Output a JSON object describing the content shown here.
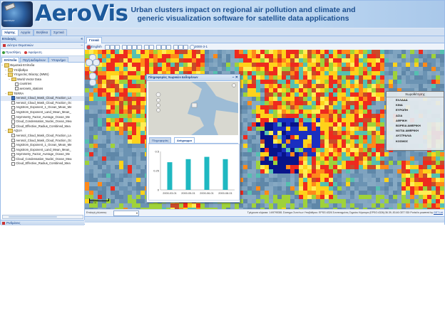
{
  "banner": {
    "brand": "AeroVis",
    "tagline": "Urban clusters impact on regional air pollution and climate and generic visualization software for satellite data applications"
  },
  "nav": {
    "tabs": [
      "Χάρτης",
      "Αρχεία",
      "Βοήθεια",
      "Σχετικά"
    ],
    "active": 0
  },
  "left_panel": {
    "title": "Επιλογές",
    "layers_header": "Δέντρο Θεματικών",
    "add_label": "Προσθήκη",
    "remove_label": "Αφαίρεση",
    "tabs": [
      "Επίπεδα",
      "Πηγή Δεδομένων",
      "Υπομνήμα"
    ],
    "tree": [
      {
        "label": "Θεματικά Επίπεδα",
        "level": 0,
        "type": "folder"
      },
      {
        "label": "Υπόβαθρα",
        "level": 1,
        "type": "folder"
      },
      {
        "label": "Υπηρεσίες Θέασης (WMS)",
        "level": 1,
        "type": "folder"
      },
      {
        "label": "World Vector Data",
        "level": 2,
        "type": "folder"
      },
      {
        "label": "countries",
        "level": 3,
        "type": "layer",
        "checked": false
      },
      {
        "label": "aeronets_stations",
        "level": 3,
        "type": "layer",
        "checked": false
      },
      {
        "label": "TERRA",
        "level": 1,
        "type": "folder"
      },
      {
        "label": "Aerosol_Cloud_Mask_Cloud_Fraction_La",
        "level": 2,
        "type": "layer",
        "checked": true,
        "selected": true
      },
      {
        "label": "Aerosol_Cloud_Mask_Cloud_Fraction_Oc",
        "level": 2,
        "type": "layer",
        "checked": false
      },
      {
        "label": "Angstrom_Exponent_1_Ocean_Mean_Me",
        "level": 2,
        "type": "layer",
        "checked": false
      },
      {
        "label": "Angstrom_Exponent_Land_Mean_Mean_",
        "level": 2,
        "type": "layer",
        "checked": false
      },
      {
        "label": "Asymmetry_Factor_Average_Ocean_Me",
        "level": 2,
        "type": "layer",
        "checked": false
      },
      {
        "label": "Cloud_Condensation_Nuclei_Ocean_Mea",
        "level": 2,
        "type": "layer",
        "checked": false
      },
      {
        "label": "Cloud_Effective_Radius_Combined_Mea",
        "level": 2,
        "type": "layer",
        "checked": false
      },
      {
        "label": "AQUA",
        "level": 1,
        "type": "folder"
      },
      {
        "label": "Aerosol_Cloud_Mask_Cloud_Fraction_La",
        "level": 2,
        "type": "layer",
        "checked": false
      },
      {
        "label": "Aerosol_Cloud_Mask_Cloud_Fraction_Oc",
        "level": 2,
        "type": "layer",
        "checked": false
      },
      {
        "label": "Angstrom_Exponent_1_Ocean_Mean_Me",
        "level": 2,
        "type": "layer",
        "checked": false
      },
      {
        "label": "Angstrom_Exponent_Land_Mean_Mean_",
        "level": 2,
        "type": "layer",
        "checked": false
      },
      {
        "label": "Asymmetry_Factor_Average_Ocean_Me",
        "level": 2,
        "type": "layer",
        "checked": false
      },
      {
        "label": "Cloud_Condensation_Nuclei_Ocean_Mea",
        "level": 2,
        "type": "layer",
        "checked": false
      },
      {
        "label": "Cloud_Effective_Radius_Combined_Mea",
        "level": 2,
        "type": "layer",
        "checked": false
      }
    ],
    "bottom_title": "Ρυθμίσεις"
  },
  "map_panel": {
    "tab": "Γενικά",
    "toolbar_lang": "English",
    "toolbar_date": "2000-3-1",
    "legend": {
      "title": "Χωροθέτησης",
      "items": [
        "ΕΛΛΑΔΑ",
        "ΚΙΝΑ",
        "ΕΥΡΩΠΗ",
        "ΑΣΙΑ",
        "ΑΦΡΙΚΗ",
        "ΒΟΡΕΙΑ ΑΜΕΡΙΚΗ",
        "ΝΟΤΙΑ ΑΜΕΡΙΚΗ",
        "ΑΥΣΤΡΑΛΙΑ",
        "ΚΟΣΜΟΣ"
      ]
    },
    "popup": {
      "title": "Πληροφορίες Χωρικών Δεδομένων",
      "tabs": [
        "Πληροφορίες",
        "Διάγραμμα"
      ],
      "active_tab": 1
    },
    "scalebar": {
      "top": "1000 km",
      "bottom": "500 mi"
    },
    "status": {
      "lang_label": "Επιλογή γλώσσας:",
      "info": "Τρέχουσα κλίμακα: 1:69795381  Σύστημα Συντ/νων Υποβάθρου: EPSG:4326  Συντεταγμένες Σημείου Κέρσορα (EPSG:4326):36.39, 83.46  GET SDI Portal is powered by ",
      "link": "GET Ltd"
    }
  },
  "chart_data": {
    "type": "bar",
    "categories": [
      "2000-03-01",
      "2000-05-01",
      "2000-06-01",
      "2000-08-01"
    ],
    "values": [
      0.36,
      0.4,
      0.43,
      0.4
    ],
    "ylim": [
      0,
      0.5
    ],
    "yticks": [
      0,
      0.25,
      0.5
    ],
    "bar_color": "#1fb8c1"
  }
}
